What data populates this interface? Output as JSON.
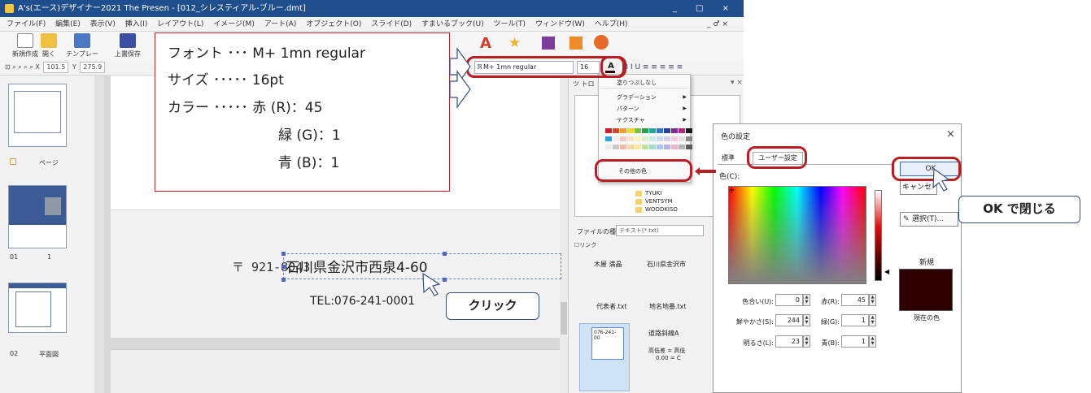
{
  "app": {
    "title": "A's(エース)デザイナー2021 The Presen - [012_シレスティアル-ブルー.dmt]",
    "window_controls": "_ □ ×",
    "menu": [
      "ファイル(F)",
      "編集(E)",
      "表示(V)",
      "挿入(I)",
      "レイアウト(L)",
      "イメージ(M)",
      "アート(A)",
      "オブジェクト(O)",
      "スライド(D)",
      "すまいるブック(U)",
      "ツール(T)",
      "ウィンドウ(W)",
      "ヘルプ(H)"
    ],
    "mdi_controls": "_ ♂ ×",
    "toolbar": [
      "新規作成",
      "開く",
      "テンプレート",
      "上書保存"
    ],
    "coord_x_label": "X",
    "coord_x": "101.5",
    "coord_y_label": "Y",
    "coord_y": "275.9",
    "font_name": "M+ 1mn regular",
    "font_size": "16",
    "color_btn": "A",
    "format_btns": "B I U ≡ ≡ ≡ ≡ ≡"
  },
  "left_panel": {
    "page_label": "ページ",
    "thumb2_num": "01",
    "thumb2_idx": "1",
    "thumb3_num": "02",
    "thumb3_name": "平面図"
  },
  "document": {
    "postal": "〒 921-8043",
    "address": "石川県金沢市西泉4-60",
    "tel": "TEL:076-241-0001"
  },
  "right_panel": {
    "title": "ツ  トロ",
    "files": [
      "TYUKI",
      "VENTSYM",
      "WOODKISO"
    ],
    "file_type_label": "ファイルの種類:",
    "file_type_value": "テキスト(*.txt)",
    "link_label": "リンク",
    "cells": [
      "木屋 満晶",
      "石川県金沢市",
      "代表者.txt",
      "地名地番.txt",
      "道路斜線A",
      "高低差 = 高低",
      "0.00 =  C"
    ],
    "thumb_text": "076-241-00"
  },
  "color_menu": {
    "no_fill": "塗りつぶしなし",
    "gradation": "グラデーション",
    "pattern": "パターン",
    "texture": "テクスチャ",
    "other_colors": "その他の色",
    "swatches": [
      "#c9202a",
      "#d9462a",
      "#e8a12b",
      "#f2d32b",
      "#7cc242",
      "#2aa24a",
      "#23a6a6",
      "#2b79c9",
      "#2a3f97",
      "#7a2b96",
      "#b3257e",
      "#1a1a1a",
      "#2aa3d9",
      "#f0f0f0",
      "#f8c9c9",
      "#f8e3c6",
      "#fbf3c4",
      "#dcefc7",
      "#c7ebe6",
      "#c8dcf2",
      "#d6cdeb",
      "#f0cde2",
      "#e0e0e0",
      "#8a8a8a",
      "#ebebeb",
      "#c8c8c8",
      "#f5b9a6",
      "#f8d6a6",
      "#f6eaa1",
      "#c3e29c",
      "#a6dcd3",
      "#a6c8ea",
      "#bcb1de",
      "#e7b3d1",
      "#b5b5b5",
      "#5b5b5b"
    ]
  },
  "callout": {
    "font_line": "フォント ･･･ M+ 1mn regular",
    "size_line": "サイズ ･････ 16pt",
    "color_line": "カラー ･････ 赤 (R)：45",
    "green_line": "緑 (G)：1",
    "blue_line": "青 (B)：1"
  },
  "dialog": {
    "title": "色の設定",
    "close": "×",
    "tab_standard": "標準",
    "tab_user": "ユーザー設定",
    "color_label": "色(C):",
    "ok": "OK",
    "cancel": "キャンセル",
    "pick": "選択(T)...",
    "new_label": "新規",
    "current_label": "現在の色",
    "hue_label": "色合い(U):",
    "hue": "0",
    "sat_label": "鮮やかさ(S):",
    "sat": "244",
    "lum_label": "明るさ(L):",
    "lum": "23",
    "red_label": "赤(R):",
    "red": "45",
    "green_label": "緑(G):",
    "green": "1",
    "blue_label": "青(B):",
    "blue": "1",
    "swatch_color": "#2d0101"
  },
  "bubbles": {
    "click": "クリック",
    "close_ok": "OK で閉じる"
  },
  "colors": {
    "highlight": "#b91e24",
    "title_bar": "#1f4e8c"
  }
}
